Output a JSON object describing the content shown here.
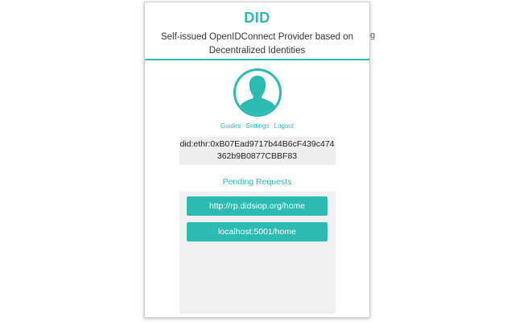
{
  "background": {
    "edge_text": "g"
  },
  "header": {
    "title": "DID",
    "subtitle": "Self-issued OpenIDConnect Provider based on Decentralized Identities"
  },
  "profile": {
    "avatar_icon": "user-silhouette-icon"
  },
  "nav": {
    "guides": "Guides",
    "settings": "Settings",
    "logout": "Logout"
  },
  "identity": {
    "did": "did:ethr:0xB07Ead9717b44B6cF439c474362b9B0877CBBF83"
  },
  "pending": {
    "title": "Pending Requests",
    "requests": [
      {
        "label": "http://rp.didsiop.org/home"
      },
      {
        "label": "localhost:5001/home"
      }
    ]
  },
  "colors": {
    "accent": "#2bbbb0",
    "panel": "#f0f0f0",
    "did_box": "#eeeeee"
  }
}
